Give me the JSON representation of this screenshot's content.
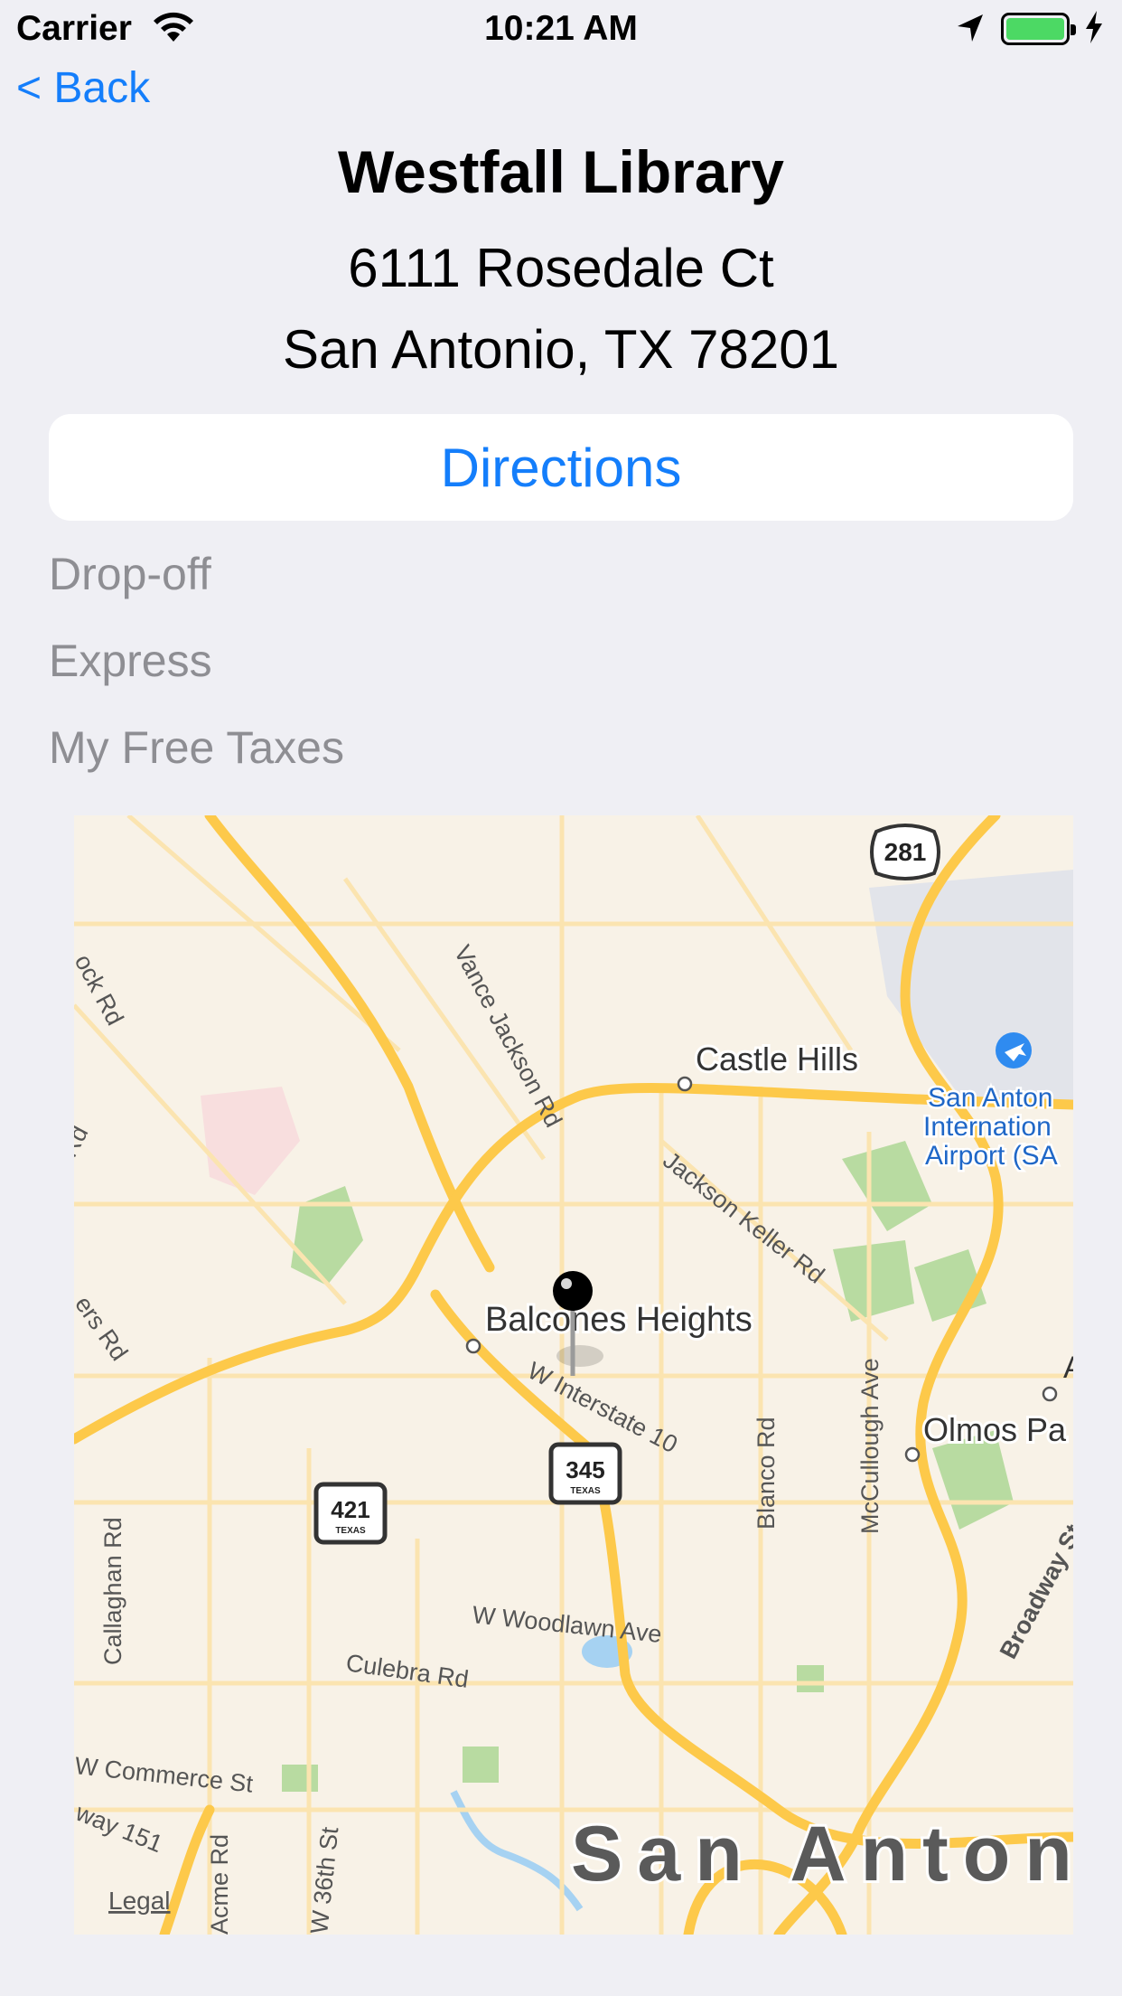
{
  "status_bar": {
    "carrier": "Carrier",
    "time": "10:21 AM",
    "battery_color": "#4cd964"
  },
  "nav": {
    "back_label": "< Back"
  },
  "location": {
    "name": "Westfall Library",
    "address_line1": "6111 Rosedale Ct",
    "address_line2": "San Antonio, TX 78201"
  },
  "directions_label": "Directions",
  "services": [
    "Drop-off",
    "Express",
    "My Free Taxes"
  ],
  "map": {
    "place_labels": {
      "castle_hills": "Castle Hills",
      "balcones_heights": "Balcones Heights",
      "olmos_park": "Olmos Pa",
      "san_antonio": "San Antoni",
      "airport_line1": "San Anton",
      "airport_line2": "Internation",
      "airport_line3": "Airport (SA"
    },
    "road_labels": {
      "vance_jackson": "Vance Jackson Rd",
      "jackson_keller": "Jackson Keller Rd",
      "interstate": "W Interstate 10",
      "blanco": "Blanco Rd",
      "mccullough": "McCullough Ave",
      "broadway": "Broadway St",
      "woodlawn": "W Woodlawn Ave",
      "culebra": "Culebra Rd",
      "callaghan": "Callaghan Rd",
      "commerce": "W Commerce St",
      "acme": "Acme Rd",
      "thirtysixth": "W 36th St",
      "way151": "way 151",
      "ock": "ock Rd",
      "rd_left": "Rd",
      "ers": "ers Rd",
      "a_right": "A"
    },
    "shields": {
      "us281": "281",
      "tx345": "345",
      "tx421": "421",
      "texas": "TEXAS"
    },
    "legal_label": "Legal",
    "pin_color": "#000000",
    "road_color": "#fdc94a"
  }
}
